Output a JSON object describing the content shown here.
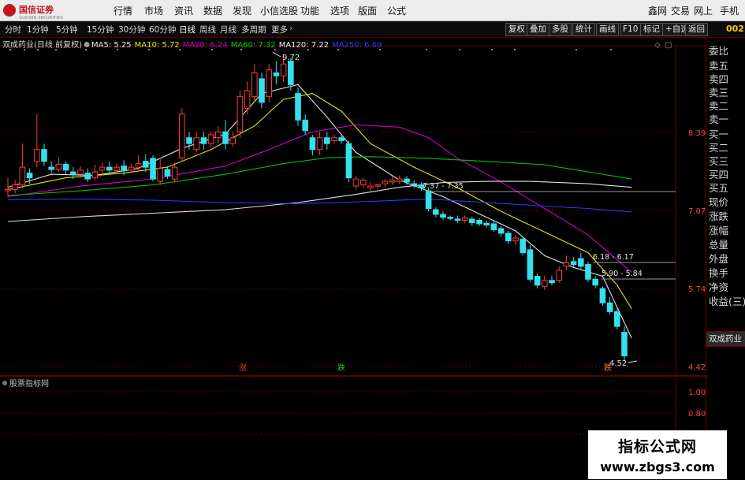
{
  "app": {
    "brand": "国信证券",
    "brand_sub": "GUOSEN SECURITIES",
    "menu": [
      "行情",
      "市场",
      "资讯",
      "数据",
      "发现",
      "小信选股",
      "功能",
      "选项",
      "版面",
      "公式"
    ],
    "menu_right": [
      "鑫网",
      "交易",
      "网上",
      "手机"
    ]
  },
  "toolbar": {
    "periods": [
      "分时",
      "1分钟",
      "5分钟",
      "15分钟",
      "30分钟",
      "60分钟",
      "日线",
      "周线",
      "月线",
      "多周期",
      "更多"
    ],
    "active_period": "日线",
    "buttons": [
      "复权",
      "叠加",
      "多股",
      "统计",
      "画线",
      "F10",
      "标记",
      "+自选",
      "返回"
    ],
    "right_code": "002"
  },
  "chart_header": {
    "title": "双成药业(日线 前复权)",
    "ma": [
      {
        "label": "MA5: 5.25",
        "color": "#e8e8e8"
      },
      {
        "label": "MA10: 5.72",
        "color": "#e6e600"
      },
      {
        "label": "MA20: 6.24",
        "color": "#d000d0"
      },
      {
        "label": "MA60: 7.32",
        "color": "#00d000"
      },
      {
        "label": "MA120: 7.22",
        "color": "#e8e8e8"
      },
      {
        "label": "MA250: 6.69",
        "color": "#2a3cff"
      }
    ]
  },
  "price_axis": [
    "8.39",
    "7.07",
    "5.74",
    "4.42"
  ],
  "annotations": {
    "high": "9.72",
    "low": "4.52",
    "ranges": [
      "7.37 - 7.35",
      "6.18 - 6.17",
      "5.90 - 5.84"
    ],
    "signals": [
      {
        "label": "涨",
        "color": "#e03a3a"
      },
      {
        "label": "跌",
        "color": "#20c020"
      },
      {
        "label": "跌",
        "color": "#e08a20"
      }
    ]
  },
  "indicator_panel": {
    "title": "股票指标网",
    "axis": [
      "1.00",
      "0.80"
    ]
  },
  "side_panel": {
    "labels": [
      "委比",
      "卖五",
      "卖四",
      "卖三",
      "卖二",
      "卖一",
      "买一",
      "买二",
      "买三",
      "买四",
      "买五",
      "现价",
      "涨跌",
      "涨幅",
      "总量",
      "外盘",
      "换手",
      "净资",
      "收益(三)"
    ],
    "stock_name": "双成药业"
  },
  "watermark": {
    "title": "指标公式网",
    "url": "www.zbgs3.com"
  },
  "colors": {
    "up": "#ff3b3b",
    "down": "#34e0ee",
    "grid": "#6a0000"
  },
  "chart_data": {
    "type": "candlestick",
    "title": "双成药业(日线 前复权)",
    "ylim": [
      4.42,
      9.9
    ],
    "y_ticks": [
      8.39,
      7.07,
      5.74,
      4.42
    ],
    "candles": [
      [
        7.4,
        7.42,
        7.3,
        7.62
      ],
      [
        7.42,
        7.5,
        7.36,
        7.58
      ],
      [
        7.5,
        7.8,
        7.44,
        8.2
      ],
      [
        7.7,
        7.62,
        7.52,
        7.78
      ],
      [
        7.9,
        8.1,
        7.8,
        8.7
      ],
      [
        8.1,
        7.9,
        7.82,
        8.2
      ],
      [
        7.8,
        7.76,
        7.7,
        7.9
      ],
      [
        7.76,
        7.85,
        7.72,
        7.96
      ],
      [
        7.85,
        7.75,
        7.68,
        7.9
      ],
      [
        7.72,
        7.68,
        7.6,
        7.8
      ],
      [
        7.68,
        7.75,
        7.62,
        7.82
      ],
      [
        7.7,
        7.6,
        7.55,
        7.78
      ],
      [
        7.62,
        7.72,
        7.58,
        7.84
      ],
      [
        7.75,
        7.8,
        7.68,
        7.88
      ],
      [
        7.8,
        7.75,
        7.7,
        7.9
      ],
      [
        7.74,
        7.8,
        7.68,
        7.86
      ],
      [
        7.82,
        7.74,
        7.66,
        7.92
      ],
      [
        7.75,
        7.8,
        7.7,
        7.86
      ],
      [
        7.8,
        7.86,
        7.72,
        8.0
      ],
      [
        7.9,
        7.8,
        7.72,
        8.02
      ],
      [
        7.95,
        7.6,
        7.56,
        8.0
      ],
      [
        7.56,
        7.78,
        7.5,
        7.96
      ],
      [
        7.76,
        7.65,
        7.6,
        7.82
      ],
      [
        7.6,
        7.8,
        7.54,
        7.88
      ],
      [
        7.96,
        8.7,
        7.9,
        8.8
      ],
      [
        8.3,
        8.2,
        8.1,
        8.4
      ],
      [
        8.1,
        8.3,
        8.05,
        8.4
      ],
      [
        8.3,
        8.2,
        8.1,
        8.4
      ],
      [
        8.2,
        8.35,
        8.15,
        8.4
      ],
      [
        8.3,
        8.4,
        8.2,
        8.5
      ],
      [
        8.4,
        8.2,
        8.1,
        8.6
      ],
      [
        8.2,
        8.3,
        8.15,
        8.4
      ],
      [
        8.4,
        9.0,
        8.3,
        9.1
      ],
      [
        8.8,
        9.1,
        8.7,
        9.25
      ],
      [
        9.0,
        9.4,
        8.9,
        9.55
      ],
      [
        9.3,
        8.9,
        8.8,
        9.4
      ],
      [
        9.0,
        9.45,
        8.9,
        9.55
      ],
      [
        9.4,
        9.35,
        9.2,
        9.6
      ],
      [
        9.35,
        9.55,
        9.25,
        9.72
      ],
      [
        9.6,
        9.2,
        9.1,
        9.65
      ],
      [
        9.05,
        8.6,
        8.5,
        9.15
      ],
      [
        8.6,
        8.42,
        8.35,
        8.7
      ],
      [
        8.3,
        8.1,
        8.0,
        8.35
      ],
      [
        8.1,
        8.3,
        8.0,
        8.4
      ],
      [
        8.3,
        8.2,
        8.1,
        8.4
      ],
      [
        8.25,
        8.3,
        8.2,
        8.35
      ],
      [
        8.3,
        8.25,
        8.2,
        8.35
      ],
      [
        8.2,
        7.62,
        7.55,
        8.25
      ],
      [
        7.48,
        7.6,
        7.42,
        7.65
      ],
      [
        7.5,
        7.58,
        7.45,
        7.62
      ],
      [
        7.45,
        7.48,
        7.4,
        7.55
      ],
      [
        7.48,
        7.5,
        7.44,
        7.52
      ],
      [
        7.52,
        7.56,
        7.46,
        7.6
      ],
      [
        7.55,
        7.58,
        7.5,
        7.64
      ],
      [
        7.56,
        7.6,
        7.52,
        7.66
      ],
      [
        7.6,
        7.55,
        7.5,
        7.65
      ],
      [
        7.52,
        7.5,
        7.45,
        7.58
      ],
      [
        7.5,
        7.45,
        7.4,
        7.55
      ],
      [
        7.4,
        7.1,
        7.05,
        7.45
      ],
      [
        7.08,
        7.0,
        6.95,
        7.12
      ],
      [
        7.0,
        6.95,
        6.9,
        7.05
      ],
      [
        6.95,
        6.93,
        6.9,
        6.98
      ],
      [
        6.92,
        6.9,
        6.85,
        6.98
      ],
      [
        6.9,
        6.94,
        6.85,
        6.98
      ],
      [
        6.92,
        6.86,
        6.8,
        6.96
      ],
      [
        6.9,
        6.84,
        6.8,
        6.94
      ],
      [
        6.85,
        6.82,
        6.78,
        6.9
      ],
      [
        6.84,
        6.74,
        6.7,
        6.88
      ],
      [
        6.76,
        6.68,
        6.62,
        6.8
      ],
      [
        6.68,
        6.55,
        6.5,
        6.72
      ],
      [
        6.55,
        6.6,
        6.48,
        6.65
      ],
      [
        6.58,
        6.35,
        6.3,
        6.62
      ],
      [
        6.4,
        5.9,
        5.85,
        6.48
      ],
      [
        5.95,
        5.8,
        5.75,
        6.0
      ],
      [
        5.78,
        5.88,
        5.72,
        5.96
      ],
      [
        5.88,
        5.84,
        5.8,
        5.96
      ],
      [
        5.88,
        6.05,
        5.84,
        6.12
      ],
      [
        6.12,
        6.18,
        6.05,
        6.3
      ],
      [
        6.2,
        6.15,
        6.1,
        6.28
      ],
      [
        6.25,
        6.12,
        6.08,
        6.35
      ],
      [
        6.15,
        5.9,
        5.85,
        6.2
      ],
      [
        5.9,
        5.8,
        5.75,
        5.95
      ],
      [
        5.74,
        5.5,
        5.45,
        5.78
      ],
      [
        5.5,
        5.35,
        5.3,
        5.6
      ],
      [
        5.35,
        5.1,
        5.05,
        5.4
      ],
      [
        5.0,
        4.6,
        4.52,
        5.1
      ]
    ],
    "ma_series": [
      {
        "name": "MA5",
        "color": "#e0e0e0",
        "pts": [
          [
            0,
            7.46
          ],
          [
            6,
            7.68
          ],
          [
            12,
            7.66
          ],
          [
            18,
            7.78
          ],
          [
            24,
            8.12
          ],
          [
            30,
            8.36
          ],
          [
            35,
            9.05
          ],
          [
            40,
            9.2
          ],
          [
            44,
            8.65
          ],
          [
            48,
            8.05
          ],
          [
            54,
            7.58
          ],
          [
            60,
            7.3
          ],
          [
            66,
            6.95
          ],
          [
            70,
            6.72
          ],
          [
            74,
            6.3
          ],
          [
            78,
            6.1
          ],
          [
            82,
            5.95
          ],
          [
            86,
            4.9
          ]
        ]
      },
      {
        "name": "MA10",
        "color": "#e6e600",
        "pts": [
          [
            0,
            7.42
          ],
          [
            8,
            7.62
          ],
          [
            16,
            7.7
          ],
          [
            22,
            7.8
          ],
          [
            28,
            8.1
          ],
          [
            34,
            8.5
          ],
          [
            38,
            8.95
          ],
          [
            42,
            9.05
          ],
          [
            46,
            8.75
          ],
          [
            50,
            8.2
          ],
          [
            56,
            7.8
          ],
          [
            62,
            7.45
          ],
          [
            68,
            7.05
          ],
          [
            74,
            6.7
          ],
          [
            80,
            6.35
          ],
          [
            84,
            5.8
          ],
          [
            86,
            5.4
          ]
        ]
      },
      {
        "name": "MA20",
        "color": "#d000d0",
        "pts": [
          [
            0,
            7.3
          ],
          [
            10,
            7.48
          ],
          [
            20,
            7.6
          ],
          [
            30,
            7.82
          ],
          [
            36,
            8.1
          ],
          [
            42,
            8.4
          ],
          [
            48,
            8.52
          ],
          [
            54,
            8.48
          ],
          [
            58,
            8.3
          ],
          [
            62,
            7.95
          ],
          [
            68,
            7.55
          ],
          [
            74,
            7.1
          ],
          [
            80,
            6.65
          ],
          [
            86,
            6.02
          ]
        ]
      },
      {
        "name": "MA60",
        "color": "#00c000",
        "pts": [
          [
            0,
            7.32
          ],
          [
            10,
            7.4
          ],
          [
            20,
            7.5
          ],
          [
            30,
            7.68
          ],
          [
            38,
            7.86
          ],
          [
            44,
            7.96
          ],
          [
            50,
            7.98
          ],
          [
            58,
            7.95
          ],
          [
            66,
            7.9
          ],
          [
            74,
            7.84
          ],
          [
            80,
            7.72
          ],
          [
            86,
            7.6
          ]
        ]
      },
      {
        "name": "MA120",
        "color": "#e0e0e0",
        "pts": [
          [
            0,
            6.88
          ],
          [
            10,
            6.96
          ],
          [
            20,
            7.02
          ],
          [
            30,
            7.08
          ],
          [
            40,
            7.2
          ],
          [
            48,
            7.34
          ],
          [
            54,
            7.46
          ],
          [
            60,
            7.54
          ],
          [
            66,
            7.56
          ],
          [
            72,
            7.56
          ],
          [
            80,
            7.52
          ],
          [
            86,
            7.46
          ]
        ]
      },
      {
        "name": "MA250",
        "color": "#2a3cff",
        "pts": [
          [
            0,
            7.25
          ],
          [
            10,
            7.26
          ],
          [
            20,
            7.24
          ],
          [
            30,
            7.2
          ],
          [
            40,
            7.18
          ],
          [
            50,
            7.22
          ],
          [
            58,
            7.26
          ],
          [
            66,
            7.2
          ],
          [
            74,
            7.14
          ],
          [
            80,
            7.1
          ],
          [
            86,
            7.04
          ]
        ]
      }
    ]
  }
}
